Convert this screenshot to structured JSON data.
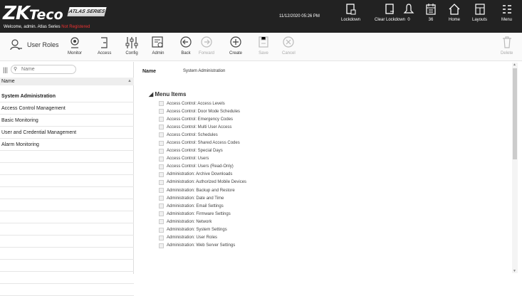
{
  "header": {
    "logo_main": "ZK",
    "logo_sub": "Teco",
    "product_badge": "ATLAS SERIES",
    "welcome_text": "Welcome, admin.",
    "site_name": "Atlas Series",
    "status_text": "Not Registered",
    "datetime": "11/12/2020 05:26 PM",
    "buttons": [
      {
        "label": "Lockdown",
        "icon": "lockdown-icon"
      },
      {
        "label": "Clear Lockdown",
        "icon": "clear-lockdown-icon"
      },
      {
        "label": "0",
        "icon": "alerts-icon"
      },
      {
        "label": "36",
        "icon": "events-icon"
      },
      {
        "label": "Home",
        "icon": "home-icon"
      },
      {
        "label": "Layouts",
        "icon": "layouts-icon"
      },
      {
        "label": "Menu",
        "icon": "menu-icon"
      }
    ]
  },
  "toolbar": {
    "page_title": "User Roles",
    "page_icon": "user-roles-icon",
    "monitor": "Monitor",
    "access": "Access",
    "config": "Config",
    "admin": "Admin",
    "back": "Back",
    "forward": "Forward",
    "create": "Create",
    "save": "Save",
    "cancel": "Cancel",
    "delete": "Delete"
  },
  "list": {
    "search_placeholder": "Name",
    "column_header": "Name",
    "rows": [
      "System Administration",
      "Access Control Management",
      "Basic Monitoring",
      "User and Credential Management",
      "Alarm Monitoring",
      "",
      "",
      "",
      "",
      "",
      "",
      "",
      "",
      "",
      "",
      "",
      ""
    ],
    "selected_index": 0
  },
  "detail": {
    "name_label": "Name",
    "name_value": "System Administration",
    "menu_items_title": "Menu Items",
    "menu_items": [
      "Access Control: Access Levels",
      "Access Control: Door Mode Schedules",
      "Access Control: Emergency Codes",
      "Access Control: Multi User Access",
      "Access Control: Schedules",
      "Access Control: Shared Access Codes",
      "Access Control: Special Days",
      "Access Control: Users",
      "Access Control: Users (Read-Only)",
      "Administration: Archive Downloads",
      "Administration: Authorized Mobile Devices",
      "Administration: Backup and Restore",
      "Administration: Date and Time",
      "Administration: Email Settings",
      "Administration: Firmware Settings",
      "Administration: Network",
      "Administration: System Settings",
      "Administration: User Roles",
      "Administration: Web Server Settings"
    ]
  }
}
